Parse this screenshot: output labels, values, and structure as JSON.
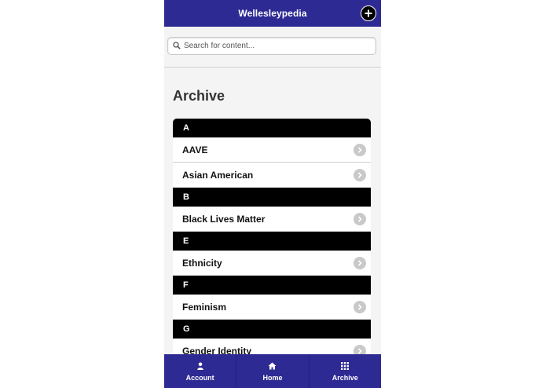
{
  "header": {
    "title": "Wellesleypedia"
  },
  "search": {
    "placeholder": "Search for content..."
  },
  "page": {
    "title": "Archive"
  },
  "sections": [
    {
      "letter": "A",
      "items": [
        "AAVE",
        "Asian American"
      ]
    },
    {
      "letter": "B",
      "items": [
        "Black Lives Matter"
      ]
    },
    {
      "letter": "E",
      "items": [
        "Ethnicity"
      ]
    },
    {
      "letter": "F",
      "items": [
        "Feminism"
      ]
    },
    {
      "letter": "G",
      "items": [
        "Gender Identity"
      ]
    }
  ],
  "footer": {
    "tabs": [
      {
        "label": "Account",
        "icon": "person-icon"
      },
      {
        "label": "Home",
        "icon": "home-icon"
      },
      {
        "label": "Archive",
        "icon": "grid-icon"
      }
    ]
  },
  "colors": {
    "brand": "#2e2a94",
    "divider": "#000000",
    "chevron": "#c9c9c9"
  }
}
